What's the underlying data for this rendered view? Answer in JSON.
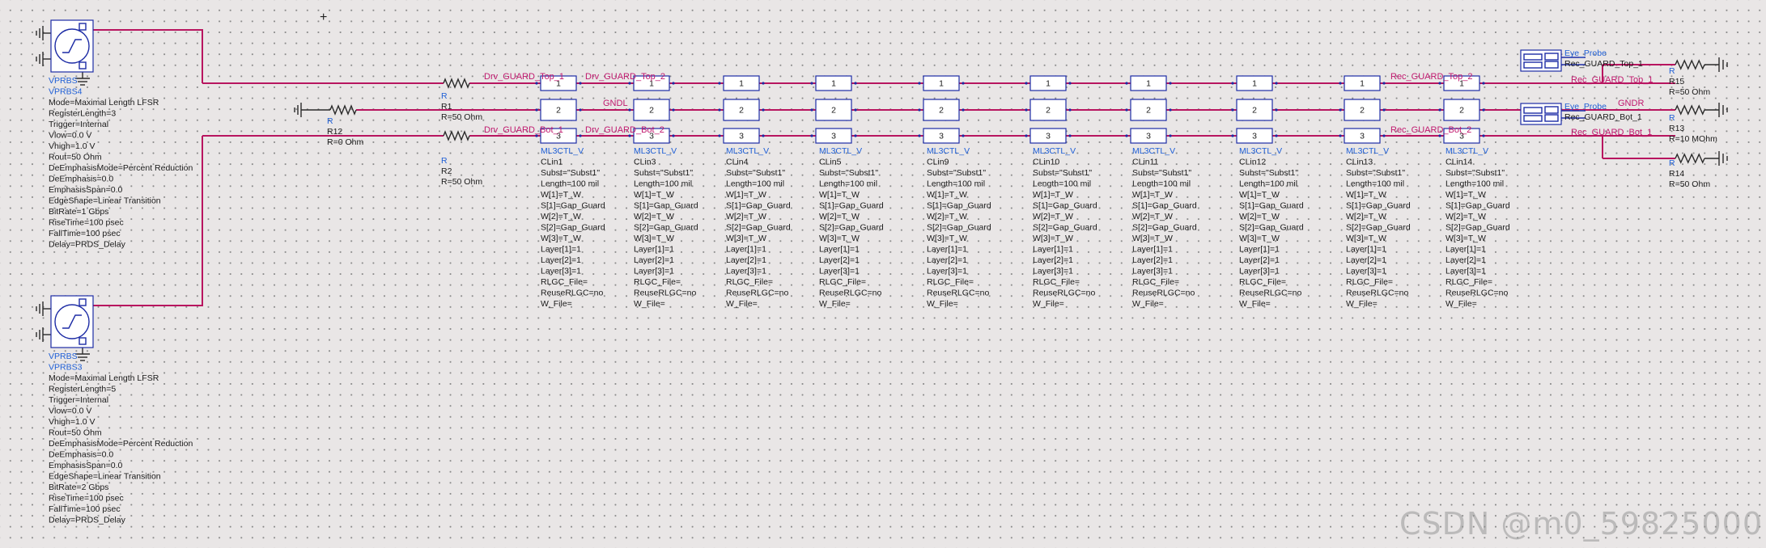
{
  "cursor": "+",
  "sources": [
    {
      "type": "VPRBS",
      "name": "VPRBS4",
      "params": [
        "Mode=Maximal Length LFSR",
        "RegisterLength=3",
        "Trigger=Internal",
        "Vlow=0.0 V",
        "Vhigh=1.0 V",
        "Rout=50 Ohm",
        "DeEmphasisMode=Percent Reduction",
        "DeEmphasis=0.0",
        "EmphasisSpan=0.0",
        "EdgeShape=Linear Transition",
        "BitRate=1 Gbps",
        "RiseTime=100 psec",
        "FallTime=100 psec",
        "Delay=PRDS_Delay"
      ]
    },
    {
      "type": "VPRBS",
      "name": "VPRBS3",
      "params": [
        "Mode=Maximal Length LFSR",
        "RegisterLength=5",
        "Trigger=Internal",
        "Vlow=0.0 V",
        "Vhigh=1.0 V",
        "Rout=50 Ohm",
        "DeEmphasisMode=Percent Reduction",
        "DeEmphasis=0.0",
        "EmphasisSpan=0.0",
        "EdgeShape=Linear Transition",
        "BitRate=2 Gbps",
        "RiseTime=100 psec",
        "FallTime=100 psec",
        "Delay=PRDS_Delay"
      ]
    }
  ],
  "input_resistors": [
    {
      "type": "R",
      "name": "R1",
      "value": "R=50 Ohm"
    },
    {
      "type": "R",
      "name": "R12",
      "value": "R=0 Ohm"
    },
    {
      "type": "R",
      "name": "R2",
      "value": "R=50 Ohm"
    }
  ],
  "nets": {
    "drv_top_1": "Drv_GUARD_Top_1",
    "drv_top_2": "Drv_GUARD_Top_2",
    "gndl": "GNDL",
    "drv_bot_1": "Drv_GUARD_Bot_1",
    "drv_bot_2": "Drv_GUARD_Bot_2",
    "rec_top_2": "Rec_GUARD_Top_2",
    "rec_top_1": "Rec_GUARD_Top_1",
    "gndr": "GNDR",
    "rec_bot_2": "Rec_GUARD_Bot_2",
    "rec_bot_1": "Rec_GUARD_Bot_1"
  },
  "lines": [
    {
      "type": "ML3CTL_V",
      "name": "CLin1"
    },
    {
      "type": "ML3CTL_V",
      "name": "CLin3"
    },
    {
      "type": "ML3CTL_V",
      "name": "CLin4"
    },
    {
      "type": "ML3CTL_V",
      "name": "CLin5"
    },
    {
      "type": "ML3CTL_V",
      "name": "CLin9"
    },
    {
      "type": "ML3CTL_V",
      "name": "CLin10"
    },
    {
      "type": "ML3CTL_V",
      "name": "CLin11"
    },
    {
      "type": "ML3CTL_V",
      "name": "CLin12"
    },
    {
      "type": "ML3CTL_V",
      "name": "CLin13"
    },
    {
      "type": "ML3CTL_V",
      "name": "CLin14"
    }
  ],
  "line_params": [
    "Subst=\"Subst1\"",
    "Length=100 mil",
    "W[1]=T_W",
    "S[1]=Gap_Guard",
    "W[2]=T_W",
    "S[2]=Gap_Guard",
    "W[3]=T_W",
    "Layer[1]=1",
    "Layer[2]=1",
    "Layer[3]=1",
    "RLGC_File=",
    "ReuseRLGC=no",
    "W_File="
  ],
  "pin_labels": [
    "1",
    "2",
    "3"
  ],
  "probes": [
    {
      "type": "Eye_Probe",
      "name": "Rec_GUARD_Top_1"
    },
    {
      "type": "Eye_Probe",
      "name": "Rec_GUARD_Bot_1"
    }
  ],
  "output_resistors": [
    {
      "type": "R",
      "name": "R15",
      "value": "R=50 Ohm"
    },
    {
      "type": "R",
      "name": "R13",
      "value": "R=10 MOhm"
    },
    {
      "type": "R",
      "name": "R14",
      "value": "R=50 Ohm"
    }
  ],
  "watermark": "CSDN @m0_59825000"
}
